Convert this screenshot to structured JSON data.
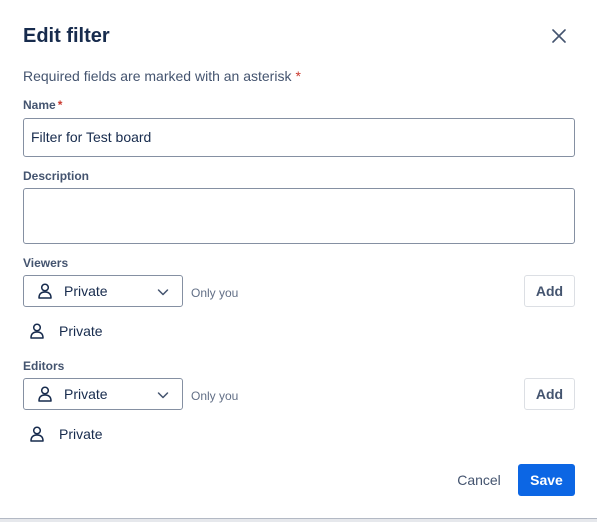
{
  "dialog": {
    "title": "Edit filter",
    "required_note": "Required fields are marked with an asterisk",
    "asterisk": "*"
  },
  "name_field": {
    "label": "Name",
    "value": "Filter for Test board"
  },
  "description_field": {
    "label": "Description",
    "value": ""
  },
  "viewers": {
    "label": "Viewers",
    "selected": "Private",
    "hint": "Only you",
    "add_label": "Add",
    "members": [
      {
        "name": "Private",
        "icon": "person-icon"
      }
    ]
  },
  "editors": {
    "label": "Editors",
    "selected": "Private",
    "hint": "Only you",
    "add_label": "Add",
    "members": [
      {
        "name": "Private",
        "icon": "person-icon"
      }
    ]
  },
  "footer": {
    "cancel_label": "Cancel",
    "save_label": "Save"
  },
  "colors": {
    "primary": "#0c66e4",
    "required": "#c9372c",
    "text": "#172b4d",
    "subtle_text": "#44546f"
  },
  "icons": {
    "close": "close-icon",
    "person": "person-icon",
    "chevron": "chevron-down-icon"
  }
}
